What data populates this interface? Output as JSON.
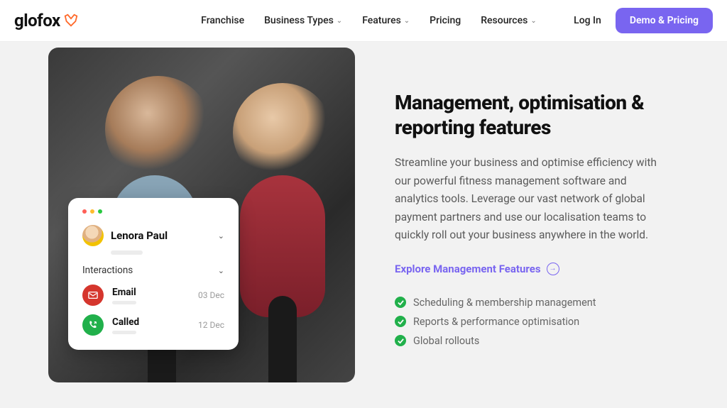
{
  "brand": {
    "name": "glofox"
  },
  "nav": {
    "items": [
      {
        "label": "Franchise",
        "dropdown": false
      },
      {
        "label": "Business Types",
        "dropdown": true
      },
      {
        "label": "Features",
        "dropdown": true
      },
      {
        "label": "Pricing",
        "dropdown": false
      },
      {
        "label": "Resources",
        "dropdown": true
      }
    ],
    "login": "Log In",
    "cta": "Demo & Pricing"
  },
  "card": {
    "profile_name": "Lenora Paul",
    "section_title": "Interactions",
    "interactions": [
      {
        "type": "Email",
        "date": "03 Dec"
      },
      {
        "type": "Called",
        "date": "12 Dec"
      }
    ]
  },
  "content": {
    "heading": "Management, optimisation & reporting features",
    "description": "Streamline your business and optimise efficiency with our powerful fitness management software and analytics tools. Leverage our vast network of global payment partners and use our localisation teams to quickly roll out your business anywhere in the world.",
    "link_text": "Explore Management Features",
    "features": [
      "Scheduling & membership management",
      "Reports & performance optimisation",
      "Global rollouts"
    ]
  }
}
